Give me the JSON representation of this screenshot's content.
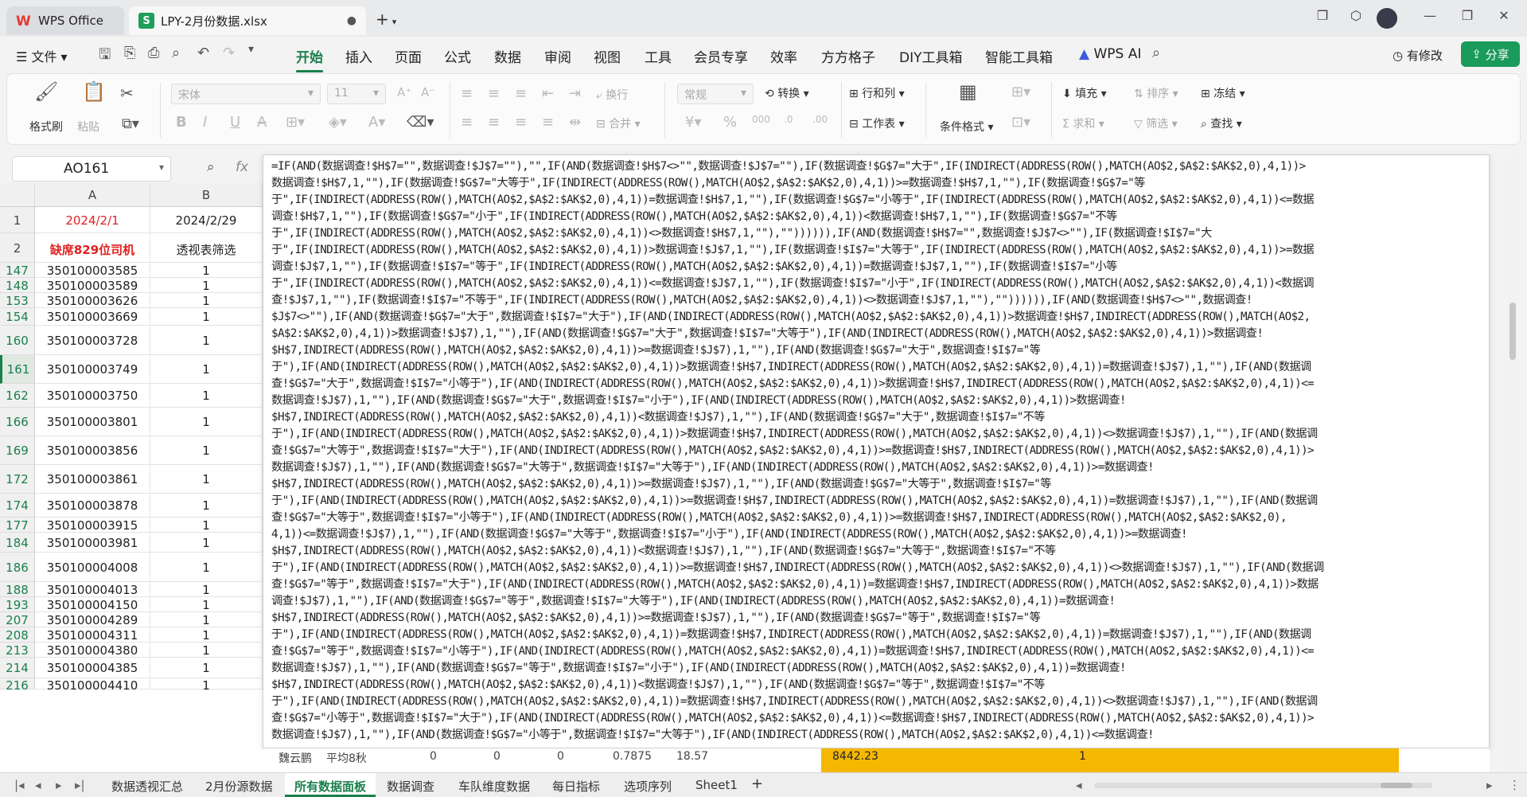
{
  "titlebar": {
    "app_tab": "WPS Office",
    "file_tab": "LPY-2月份数据.xlsx",
    "add_tab": "+"
  },
  "menubar": {
    "file_menu": "文件",
    "items": [
      "开始",
      "插入",
      "页面",
      "公式",
      "数据",
      "审阅",
      "视图",
      "工具",
      "会员专享",
      "效率",
      "方方格子",
      "DIY工具箱",
      "智能工具箱",
      "WPS AI"
    ],
    "active": "开始",
    "has_change": "有修改",
    "share": "分享"
  },
  "ribbon": {
    "format_painter": "格式刷",
    "paste": "粘贴",
    "font_name": "宋体",
    "font_size": "11",
    "wrap": "换行",
    "merge": "合并",
    "number_format": "常规",
    "convert": "转换",
    "row_col": "行和列",
    "worksheet": "工作表",
    "cond_format": "条件格式",
    "fill": "填充",
    "sort": "排序",
    "freeze": "冻结",
    "sum": "求和",
    "filter": "筛选",
    "find": "查找"
  },
  "formula_bar": {
    "name_box": "AO161",
    "fx": "fx"
  },
  "grid": {
    "columns": [
      "A",
      "B"
    ],
    "header_rows": [
      {
        "row": "1",
        "a": "2024/2/1",
        "b": "2024/2/29"
      },
      {
        "row": "2",
        "a": "缺席829位司机",
        "b": "透视表筛选"
      }
    ],
    "rows": [
      {
        "row": "147",
        "a": "350100003585",
        "b": "1"
      },
      {
        "row": "148",
        "a": "350100003589",
        "b": "1"
      },
      {
        "row": "153",
        "a": "350100003626",
        "b": "1"
      },
      {
        "row": "154",
        "a": "350100003669",
        "b": "1"
      },
      {
        "row": "160",
        "a": "350100003728",
        "b": "1"
      },
      {
        "row": "161",
        "a": "350100003749",
        "b": "1"
      },
      {
        "row": "162",
        "a": "350100003750",
        "b": "1"
      },
      {
        "row": "166",
        "a": "350100003801",
        "b": "1"
      },
      {
        "row": "169",
        "a": "350100003856",
        "b": "1"
      },
      {
        "row": "172",
        "a": "350100003861",
        "b": "1"
      },
      {
        "row": "174",
        "a": "350100003878",
        "b": "1"
      },
      {
        "row": "177",
        "a": "350100003915",
        "b": "1"
      },
      {
        "row": "184",
        "a": "350100003981",
        "b": "1"
      },
      {
        "row": "186",
        "a": "350100004008",
        "b": "1"
      },
      {
        "row": "188",
        "a": "350100004013",
        "b": "1"
      },
      {
        "row": "193",
        "a": "350100004150",
        "b": "1"
      },
      {
        "row": "207",
        "a": "350100004289",
        "b": "1"
      },
      {
        "row": "208",
        "a": "350100004311",
        "b": "1"
      },
      {
        "row": "213",
        "a": "350100004380",
        "b": "1"
      },
      {
        "row": "214",
        "a": "350100004385",
        "b": "1"
      },
      {
        "row": "216",
        "a": "350100004410",
        "b": "1"
      }
    ]
  },
  "formula_lines": [
    "=IF(AND(数据调查!$H$7=\"\",数据调查!$J$7=\"\"),\"\",IF(AND(数据调查!$H$7<>\"\",数据调查!$J$7=\"\"),IF(数据调查!$G$7=\"大于\",IF(INDIRECT(ADDRESS(ROW(),MATCH(AO$2,$A$2:$AK$2,0),4,1))>",
    "数据调查!$H$7,1,\"\"),IF(数据调查!$G$7=\"大等于\",IF(INDIRECT(ADDRESS(ROW(),MATCH(AO$2,$A$2:$AK$2,0),4,1))>=数据调查!$H$7,1,\"\"),IF(数据调查!$G$7=\"等",
    "于\",IF(INDIRECT(ADDRESS(ROW(),MATCH(AO$2,$A$2:$AK$2,0),4,1))=数据调查!$H$7,1,\"\"),IF(数据调查!$G$7=\"小等于\",IF(INDIRECT(ADDRESS(ROW(),MATCH(AO$2,$A$2:$AK$2,0),4,1))<=数据",
    "调查!$H$7,1,\"\"),IF(数据调查!$G$7=\"小于\",IF(INDIRECT(ADDRESS(ROW(),MATCH(AO$2,$A$2:$AK$2,0),4,1))<数据调查!$H$7,1,\"\"),IF(数据调查!$G$7=\"不等",
    "于\",IF(INDIRECT(ADDRESS(ROW(),MATCH(AO$2,$A$2:$AK$2,0),4,1))<>数据调查!$H$7,1,\"\"),\"\")))))),IF(AND(数据调查!$H$7=\"\",数据调查!$J$7<>\"\"),IF(数据调查!$I$7=\"大",
    "于\",IF(INDIRECT(ADDRESS(ROW(),MATCH(AO$2,$A$2:$AK$2,0),4,1))>数据调查!$J$7,1,\"\"),IF(数据调查!$I$7=\"大等于\",IF(INDIRECT(ADDRESS(ROW(),MATCH(AO$2,$A$2:$AK$2,0),4,1))>=数据",
    "调查!$J$7,1,\"\"),IF(数据调查!$I$7=\"等于\",IF(INDIRECT(ADDRESS(ROW(),MATCH(AO$2,$A$2:$AK$2,0),4,1))=数据调查!$J$7,1,\"\"),IF(数据调查!$I$7=\"小等",
    "于\",IF(INDIRECT(ADDRESS(ROW(),MATCH(AO$2,$A$2:$AK$2,0),4,1))<=数据调查!$J$7,1,\"\"),IF(数据调查!$I$7=\"小于\",IF(INDIRECT(ADDRESS(ROW(),MATCH(AO$2,$A$2:$AK$2,0),4,1))<数据调",
    "查!$J$7,1,\"\"),IF(数据调查!$I$7=\"不等于\",IF(INDIRECT(ADDRESS(ROW(),MATCH(AO$2,$A$2:$AK$2,0),4,1))<>数据调查!$J$7,1,\"\"),\"\")))))),IF(AND(数据调查!$H$7<>\"\",数据调查!",
    "$J$7<>\"\"),IF(AND(数据调查!$G$7=\"大于\",数据调查!$I$7=\"大于\"),IF(AND(INDIRECT(ADDRESS(ROW(),MATCH(AO$2,$A$2:$AK$2,0),4,1))>数据调查!$H$7,INDIRECT(ADDRESS(ROW(),MATCH(AO$2,",
    "$A$2:$AK$2,0),4,1))>数据调查!$J$7),1,\"\"),IF(AND(数据调查!$G$7=\"大于\",数据调查!$I$7=\"大等于\"),IF(AND(INDIRECT(ADDRESS(ROW(),MATCH(AO$2,$A$2:$AK$2,0),4,1))>数据调查!",
    "$H$7,INDIRECT(ADDRESS(ROW(),MATCH(AO$2,$A$2:$AK$2,0),4,1))>=数据调查!$J$7),1,\"\"),IF(AND(数据调查!$G$7=\"大于\",数据调查!$I$7=\"等",
    "于\"),IF(AND(INDIRECT(ADDRESS(ROW(),MATCH(AO$2,$A$2:$AK$2,0),4,1))>数据调查!$H$7,INDIRECT(ADDRESS(ROW(),MATCH(AO$2,$A$2:$AK$2,0),4,1))=数据调查!$J$7),1,\"\"),IF(AND(数据调",
    "查!$G$7=\"大于\",数据调查!$I$7=\"小等于\"),IF(AND(INDIRECT(ADDRESS(ROW(),MATCH(AO$2,$A$2:$AK$2,0),4,1))>数据调查!$H$7,INDIRECT(ADDRESS(ROW(),MATCH(AO$2,$A$2:$AK$2,0),4,1))<=",
    "数据调查!$J$7),1,\"\"),IF(AND(数据调查!$G$7=\"大于\",数据调查!$I$7=\"小于\"),IF(AND(INDIRECT(ADDRESS(ROW(),MATCH(AO$2,$A$2:$AK$2,0),4,1))>数据调查!",
    "$H$7,INDIRECT(ADDRESS(ROW(),MATCH(AO$2,$A$2:$AK$2,0),4,1))<数据调查!$J$7),1,\"\"),IF(AND(数据调查!$G$7=\"大于\",数据调查!$I$7=\"不等",
    "于\"),IF(AND(INDIRECT(ADDRESS(ROW(),MATCH(AO$2,$A$2:$AK$2,0),4,1))>数据调查!$H$7,INDIRECT(ADDRESS(ROW(),MATCH(AO$2,$A$2:$AK$2,0),4,1))<>数据调查!$J$7),1,\"\"),IF(AND(数据调",
    "查!$G$7=\"大等于\",数据调查!$I$7=\"大于\"),IF(AND(INDIRECT(ADDRESS(ROW(),MATCH(AO$2,$A$2:$AK$2,0),4,1))>=数据调查!$H$7,INDIRECT(ADDRESS(ROW(),MATCH(AO$2,$A$2:$AK$2,0),4,1))>",
    "数据调查!$J$7),1,\"\"),IF(AND(数据调查!$G$7=\"大等于\",数据调查!$I$7=\"大等于\"),IF(AND(INDIRECT(ADDRESS(ROW(),MATCH(AO$2,$A$2:$AK$2,0),4,1))>=数据调查!",
    "$H$7,INDIRECT(ADDRESS(ROW(),MATCH(AO$2,$A$2:$AK$2,0),4,1))>=数据调查!$J$7),1,\"\"),IF(AND(数据调查!$G$7=\"大等于\",数据调查!$I$7=\"等",
    "于\"),IF(AND(INDIRECT(ADDRESS(ROW(),MATCH(AO$2,$A$2:$AK$2,0),4,1))>=数据调查!$H$7,INDIRECT(ADDRESS(ROW(),MATCH(AO$2,$A$2:$AK$2,0),4,1))=数据调查!$J$7),1,\"\"),IF(AND(数据调",
    "查!$G$7=\"大等于\",数据调查!$I$7=\"小等于\"),IF(AND(INDIRECT(ADDRESS(ROW(),MATCH(AO$2,$A$2:$AK$2,0),4,1))>=数据调查!$H$7,INDIRECT(ADDRESS(ROW(),MATCH(AO$2,$A$2:$AK$2,0),",
    "4,1))<=数据调查!$J$7),1,\"\"),IF(AND(数据调查!$G$7=\"大等于\",数据调查!$I$7=\"小于\"),IF(AND(INDIRECT(ADDRESS(ROW(),MATCH(AO$2,$A$2:$AK$2,0),4,1))>=数据调查!",
    "$H$7,INDIRECT(ADDRESS(ROW(),MATCH(AO$2,$A$2:$AK$2,0),4,1))<数据调查!$J$7),1,\"\"),IF(AND(数据调查!$G$7=\"大等于\",数据调查!$I$7=\"不等",
    "于\"),IF(AND(INDIRECT(ADDRESS(ROW(),MATCH(AO$2,$A$2:$AK$2,0),4,1))>=数据调查!$H$7,INDIRECT(ADDRESS(ROW(),MATCH(AO$2,$A$2:$AK$2,0),4,1))<>数据调查!$J$7),1,\"\"),IF(AND(数据调",
    "查!$G$7=\"等于\",数据调查!$I$7=\"大于\"),IF(AND(INDIRECT(ADDRESS(ROW(),MATCH(AO$2,$A$2:$AK$2,0),4,1))=数据调查!$H$7,INDIRECT(ADDRESS(ROW(),MATCH(AO$2,$A$2:$AK$2,0),4,1))>数据",
    "调查!$J$7),1,\"\"),IF(AND(数据调查!$G$7=\"等于\",数据调查!$I$7=\"大等于\"),IF(AND(INDIRECT(ADDRESS(ROW(),MATCH(AO$2,$A$2:$AK$2,0),4,1))=数据调查!",
    "$H$7,INDIRECT(ADDRESS(ROW(),MATCH(AO$2,$A$2:$AK$2,0),4,1))>=数据调查!$J$7),1,\"\"),IF(AND(数据调查!$G$7=\"等于\",数据调查!$I$7=\"等",
    "于\"),IF(AND(INDIRECT(ADDRESS(ROW(),MATCH(AO$2,$A$2:$AK$2,0),4,1))=数据调查!$H$7,INDIRECT(ADDRESS(ROW(),MATCH(AO$2,$A$2:$AK$2,0),4,1))=数据调查!$J$7),1,\"\"),IF(AND(数据调",
    "查!$G$7=\"等于\",数据调查!$I$7=\"小等于\"),IF(AND(INDIRECT(ADDRESS(ROW(),MATCH(AO$2,$A$2:$AK$2,0),4,1))=数据调查!$H$7,INDIRECT(ADDRESS(ROW(),MATCH(AO$2,$A$2:$AK$2,0),4,1))<=",
    "数据调查!$J$7),1,\"\"),IF(AND(数据调查!$G$7=\"等于\",数据调查!$I$7=\"小于\"),IF(AND(INDIRECT(ADDRESS(ROW(),MATCH(AO$2,$A$2:$AK$2,0),4,1))=数据调查!",
    "$H$7,INDIRECT(ADDRESS(ROW(),MATCH(AO$2,$A$2:$AK$2,0),4,1))<数据调查!$J$7),1,\"\"),IF(AND(数据调查!$G$7=\"等于\",数据调查!$I$7=\"不等",
    "于\"),IF(AND(INDIRECT(ADDRESS(ROW(),MATCH(AO$2,$A$2:$AK$2,0),4,1))=数据调查!$H$7,INDIRECT(ADDRESS(ROW(),MATCH(AO$2,$A$2:$AK$2,0),4,1))<>数据调查!$J$7),1,\"\"),IF(AND(数据调",
    "查!$G$7=\"小等于\",数据调查!$I$7=\"大于\"),IF(AND(INDIRECT(ADDRESS(ROW(),MATCH(AO$2,$A$2:$AK$2,0),4,1))<=数据调查!$H$7,INDIRECT(ADDRESS(ROW(),MATCH(AO$2,$A$2:$AK$2,0),4,1))>",
    "数据调查!$J$7),1,\"\"),IF(AND(数据调查!$G$7=\"小等于\",数据调查!$I$7=\"大等于\"),IF(AND(INDIRECT(ADDRESS(ROW(),MATCH(AO$2,$A$2:$AK$2,0),4,1))<=数据调查!"
  ],
  "bottom_row": {
    "c1": "魏云鹏",
    "c2": "平均8秋",
    "c3": "0",
    "c4": "0",
    "c5": "0",
    "c6": "0.7875",
    "c7": "18.57",
    "c8": "8442.23",
    "c9": "1"
  },
  "sheets": {
    "tabs": [
      "数据透视汇总",
      "2月份源数据",
      "所有数据面板",
      "数据调查",
      "车队维度数据",
      "每日指标",
      "选项序列",
      "Sheet1"
    ],
    "active": "所有数据面板",
    "add": "+"
  },
  "colors": {
    "accent": "#1a7f4b",
    "header_red": "#e02020",
    "highlight": "#f5b800"
  }
}
